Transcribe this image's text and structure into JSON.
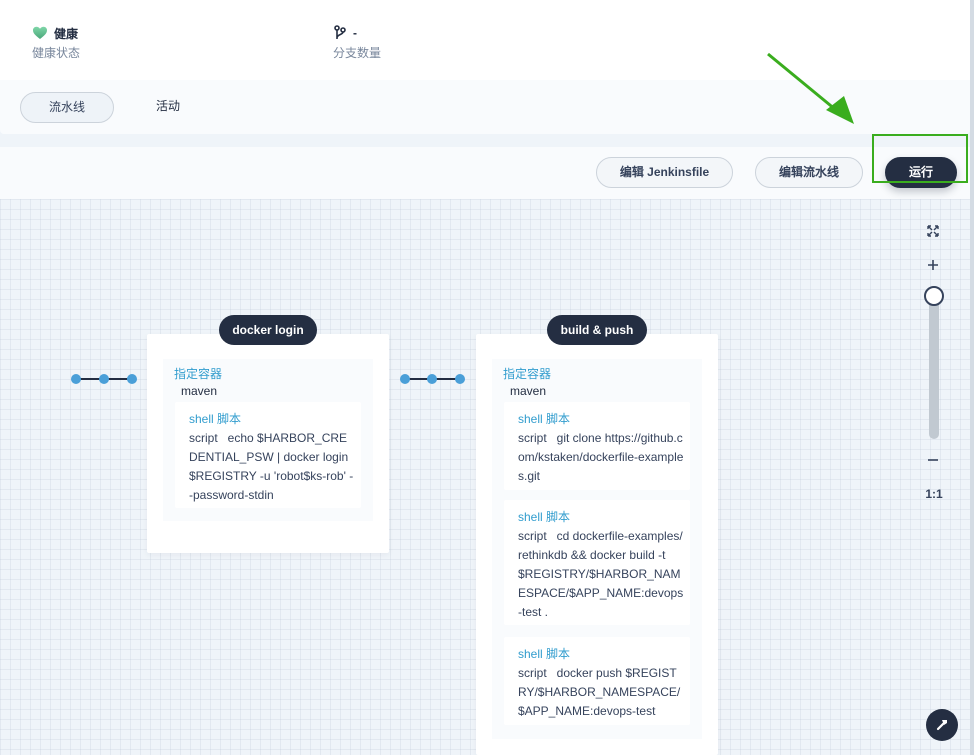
{
  "info": {
    "health_value": "健康",
    "health_label": "健康状态",
    "branch_value": "-",
    "branch_label": "分支数量"
  },
  "tabs": [
    {
      "label": "流水线",
      "active": true
    },
    {
      "label": "活动",
      "active": false
    }
  ],
  "toolbar": {
    "edit_jenkinsfile": "编辑 Jenkinsfile",
    "edit_pipeline": "编辑流水线",
    "run": "运行"
  },
  "stages": [
    {
      "title": "docker login",
      "container_label": "指定容器",
      "container_name": "maven",
      "steps": [
        {
          "title": "shell 脚本",
          "key": "script",
          "value": "echo $HARBOR_CREDENTIAL_PSW | docker login $REGISTRY -u 'robot$ks-rob' --password-stdin"
        }
      ]
    },
    {
      "title": "build & push",
      "container_label": "指定容器",
      "container_name": "maven",
      "steps": [
        {
          "title": "shell 脚本",
          "key": "script",
          "value": "git clone https://github.com/kstaken/dockerfile-examples.git"
        },
        {
          "title": "shell 脚本",
          "key": "script",
          "value": "cd dockerfile-examples/rethinkdb && docker build -t $REGISTRY/$HARBOR_NAMESPACE/$APP_NAME:devops-test ."
        },
        {
          "title": "shell 脚本",
          "key": "script",
          "value": "docker push $REGISTRY/$HARBOR_NAMESPACE/$APP_NAME:devops-test"
        }
      ]
    }
  ],
  "zoom": {
    "ratio_label": "1:1",
    "level": 1.0
  },
  "colors": {
    "accent_dark": "#242e42",
    "link_blue": "#329dce",
    "highlight_green": "#3aad1e",
    "health_green": "#55bc8a"
  }
}
